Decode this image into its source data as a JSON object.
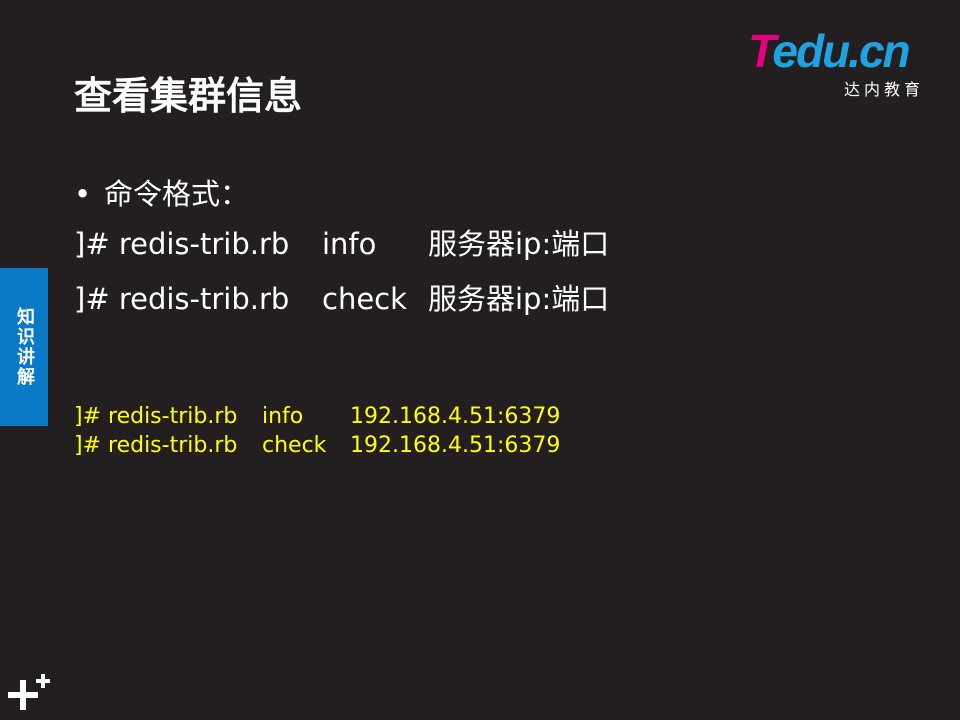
{
  "logo": {
    "word_t": "T",
    "word_rest": "edu.cn",
    "subtitle": "达内教育",
    "colors": {
      "t": "#e6007e",
      "rest": "#1fa3e0"
    }
  },
  "title": "查看集群信息",
  "side_tab": "知识讲解",
  "bullet": {
    "marker": "•",
    "text": "命令格式："
  },
  "commands": [
    {
      "prefix": "]# redis-trib.rb",
      "action": "info",
      "target": "服务器ip:端口"
    },
    {
      "prefix": "]# redis-trib.rb",
      "action": "check",
      "target": "服务器ip:端口"
    }
  ],
  "examples": [
    {
      "prefix": "]# redis-trib.rb",
      "action": "info",
      "target": "192.168.4.51:6379"
    },
    {
      "prefix": "]# redis-trib.rb",
      "action": "check",
      "target": "192.168.4.51:6379"
    }
  ],
  "colors": {
    "background": "#231f20",
    "side_tab": "#0a79c8",
    "example_text": "#ffff00"
  },
  "icons": {
    "bottom_left": "plus-icon"
  }
}
